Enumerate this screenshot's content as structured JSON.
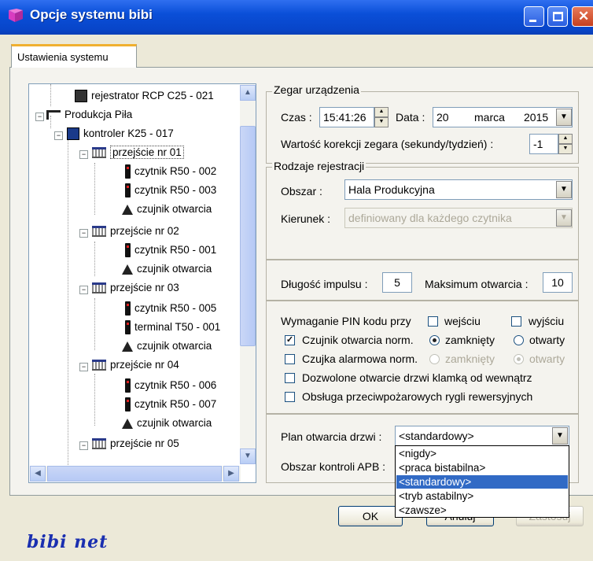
{
  "window": {
    "title": "Opcje systemu bibi",
    "accent": "#0a4fd8"
  },
  "tab": {
    "label": "Ustawienia systemu"
  },
  "tree": {
    "nodes": [
      {
        "label": "rejestrator RCP C25 - 021",
        "icon": "recorder-icon"
      },
      {
        "label": "Produkcja Piła",
        "icon": "production-icon"
      },
      {
        "label": "kontroler K25 - 017",
        "icon": "controller-icon"
      },
      {
        "label": "przejście nr 01",
        "icon": "door-icon"
      },
      {
        "label": "czytnik R50 - 002",
        "icon": "reader-icon"
      },
      {
        "label": "czytnik R50 - 003",
        "icon": "reader-icon"
      },
      {
        "label": "czujnik otwarcia",
        "icon": "sensor-icon"
      },
      {
        "label": "przejście nr 02",
        "icon": "door-icon"
      },
      {
        "label": "czytnik R50 - 001",
        "icon": "reader-icon"
      },
      {
        "label": "czujnik otwarcia",
        "icon": "sensor-icon"
      },
      {
        "label": "przejście nr 03",
        "icon": "door-icon"
      },
      {
        "label": "czytnik R50 - 005",
        "icon": "reader-icon"
      },
      {
        "label": "terminal T50 - 001",
        "icon": "reader-icon"
      },
      {
        "label": "czujnik otwarcia",
        "icon": "sensor-icon"
      },
      {
        "label": "przejście nr 04",
        "icon": "door-icon"
      },
      {
        "label": "czytnik R50 - 006",
        "icon": "reader-icon"
      },
      {
        "label": "czytnik R50 - 007",
        "icon": "reader-icon"
      },
      {
        "label": "czujnik otwarcia",
        "icon": "sensor-icon"
      },
      {
        "label": "przejście nr 05",
        "icon": "door-icon"
      }
    ]
  },
  "clock": {
    "group_label": "Zegar urządzenia",
    "time_label": "Czas :",
    "time_value": "15:41:26",
    "date_label": "Data :",
    "date_day": "20",
    "date_month": "marca",
    "date_year": "2015",
    "correction_label": "Wartość korekcji zegara (sekundy/tydzień) :",
    "correction_value": "-1"
  },
  "registration": {
    "group_label": "Rodzaje rejestracji",
    "area_label": "Obszar :",
    "area_value": "Hala Produkcyjna",
    "direction_label": "Kierunek :",
    "direction_value": "definiowany dla każdego czytnika"
  },
  "impulse": {
    "length_label": "Długość impulsu :",
    "length_value": "5",
    "max_label": "Maksimum otwarcia :",
    "max_value": "10"
  },
  "pin": {
    "label": "Wymaganie PIN kodu przy",
    "entry": "wejściu",
    "exit": "wyjściu",
    "entry_checked": false,
    "exit_checked": false
  },
  "sensor": {
    "label": "Czujnik otwarcia norm.",
    "checked": true,
    "closed": "zamknięty",
    "open": "otwarty",
    "selected": "closed"
  },
  "alarm": {
    "label": "Czujka alarmowa norm.",
    "checked": false,
    "closed": "zamknięty",
    "open": "otwarty",
    "selected": "open"
  },
  "handle": {
    "label": "Dozwolone otwarcie drzwi klamką od wewnątrz",
    "checked": false
  },
  "fire": {
    "label": "Obsługa przeciwpożarowych rygli rewersyjnych",
    "checked": false
  },
  "plan": {
    "label": "Plan otwarcia drzwi :",
    "value": "<standardowy>",
    "options": [
      "<nigdy>",
      "<praca bistabilna>",
      "<standardowy>",
      "<tryb astabilny>",
      "<zawsze>"
    ],
    "selected_index": 2
  },
  "apb": {
    "label": "Obszar kontroli APB :"
  },
  "buttons": {
    "ok": "OK",
    "cancel": "Anuluj",
    "apply": "Zastosuj"
  },
  "logo": {
    "text": "bibi net"
  }
}
